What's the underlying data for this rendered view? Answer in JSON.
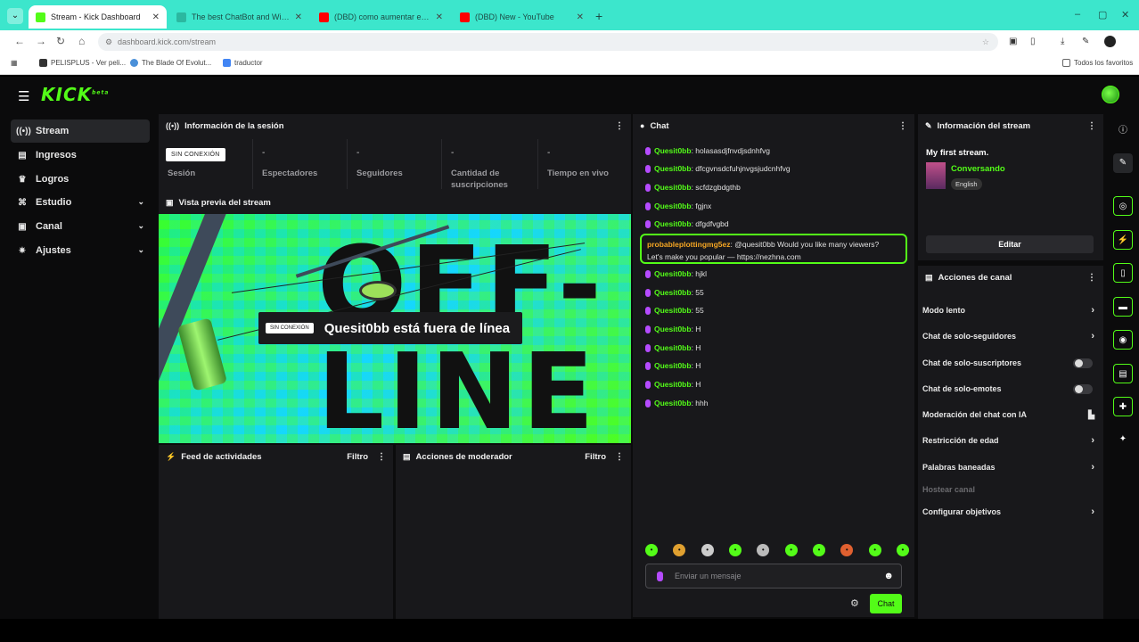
{
  "browser": {
    "tabs": [
      {
        "title": "Stream - Kick Dashboard",
        "color": "#53fc18"
      },
      {
        "title": "The best ChatBot and Widget f...",
        "color": "#2bb8a0"
      },
      {
        "title": "(DBD) como aumentar el bebo...",
        "color": "#ff0000"
      },
      {
        "title": "(DBD) New - YouTube",
        "color": "#ff0000"
      }
    ],
    "url": "dashboard.kick.com/stream",
    "bookmarks": [
      "PELISPLUS - Ver peli...",
      "The Blade Of Evolut...",
      "traductor"
    ],
    "all_bookmarks": "Todos los favoritos"
  },
  "sidebar": {
    "items": [
      {
        "label": "Stream",
        "icon": "broadcast-icon"
      },
      {
        "label": "Ingresos",
        "icon": "wallet-icon"
      },
      {
        "label": "Logros",
        "icon": "trophy-icon"
      },
      {
        "label": "Estudio",
        "icon": "studio-icon"
      },
      {
        "label": "Canal",
        "icon": "tv-icon"
      },
      {
        "label": "Ajustes",
        "icon": "gear-icon"
      }
    ]
  },
  "session": {
    "title": "Información de la sesión",
    "badge": "SIN CONEXIÓN",
    "stats": [
      {
        "value": "",
        "label": "Sesión"
      },
      {
        "value": "-",
        "label": "Espectadores"
      },
      {
        "value": "-",
        "label": "Seguidores"
      },
      {
        "value": "-",
        "label": "Cantidad de suscripciones"
      },
      {
        "value": "-",
        "label": "Tiempo en vivo"
      }
    ]
  },
  "preview": {
    "title": "Vista previa del stream",
    "big_text_1": "OFF-",
    "big_text_2": "LINE",
    "badge": "SIN CONEXIÓN",
    "message": "Quesit0bb está fuera de línea"
  },
  "activity": {
    "title": "Feed de actividades",
    "filter": "Filtro"
  },
  "moderator": {
    "title": "Acciones de moderador",
    "filter": "Filtro"
  },
  "chat": {
    "title": "Chat",
    "messages_top": [
      {
        "user": "Quesit0bb",
        "text": ": holasasdjfnvdjsdnhfvg"
      },
      {
        "user": "Quesit0bb",
        "text": ": dfcgvnsdcfuhjnvgsjudcnhfvg"
      },
      {
        "user": "Quesit0bb",
        "text": ": scfdzgbdgthb"
      },
      {
        "user": "Quesit0bb",
        "text": ": fgjnx"
      },
      {
        "user": "Quesit0bb",
        "text": ": dfgdfvgbd"
      }
    ],
    "highlight": {
      "user": "probableplottingmg5ez",
      "line1": ": @quesit0bb Would you like many viewers?",
      "line2": "Let's make you popular — https://nezhna.com"
    },
    "messages_bottom": [
      {
        "user": "Quesit0bb",
        "text": ": hjkl"
      },
      {
        "user": "Quesit0bb",
        "text": ": 55"
      },
      {
        "user": "Quesit0bb",
        "text": ": 55"
      },
      {
        "user": "Quesit0bb",
        "text": ": H"
      },
      {
        "user": "Quesit0bb",
        "text": ": H"
      },
      {
        "user": "Quesit0bb",
        "text": ": H"
      },
      {
        "user": "Quesit0bb",
        "text": ": H"
      },
      {
        "user": "Quesit0bb",
        "text": ": hhh"
      }
    ],
    "input_placeholder": "Enviar un mensaje",
    "send_label": "Chat"
  },
  "stream_info": {
    "title": "Información del stream",
    "stream_title": "My first stream.",
    "category": "Conversando",
    "tag": "English",
    "edit_label": "Editar"
  },
  "channel_actions": {
    "title": "Acciones de canal",
    "items": [
      {
        "label": "Modo lento",
        "control": "arrow"
      },
      {
        "label": "Chat de solo-seguidores",
        "control": "arrow"
      },
      {
        "label": "Chat de solo-suscriptores",
        "control": "toggle"
      },
      {
        "label": "Chat de solo-emotes",
        "control": "toggle"
      },
      {
        "label": "Moderación del chat con IA",
        "control": "chart"
      },
      {
        "label": "Restricción de edad",
        "control": "arrow"
      },
      {
        "label": "Palabras baneadas",
        "control": "arrow"
      },
      {
        "label": "Hostear canal",
        "control": "none"
      },
      {
        "label": "Configurar objetivos",
        "control": "arrow"
      }
    ]
  },
  "colors": {
    "accent": "#53fc18",
    "panel": "#18181b",
    "background": "#0b0b0c",
    "browser_tab": "#3ce6cc"
  }
}
